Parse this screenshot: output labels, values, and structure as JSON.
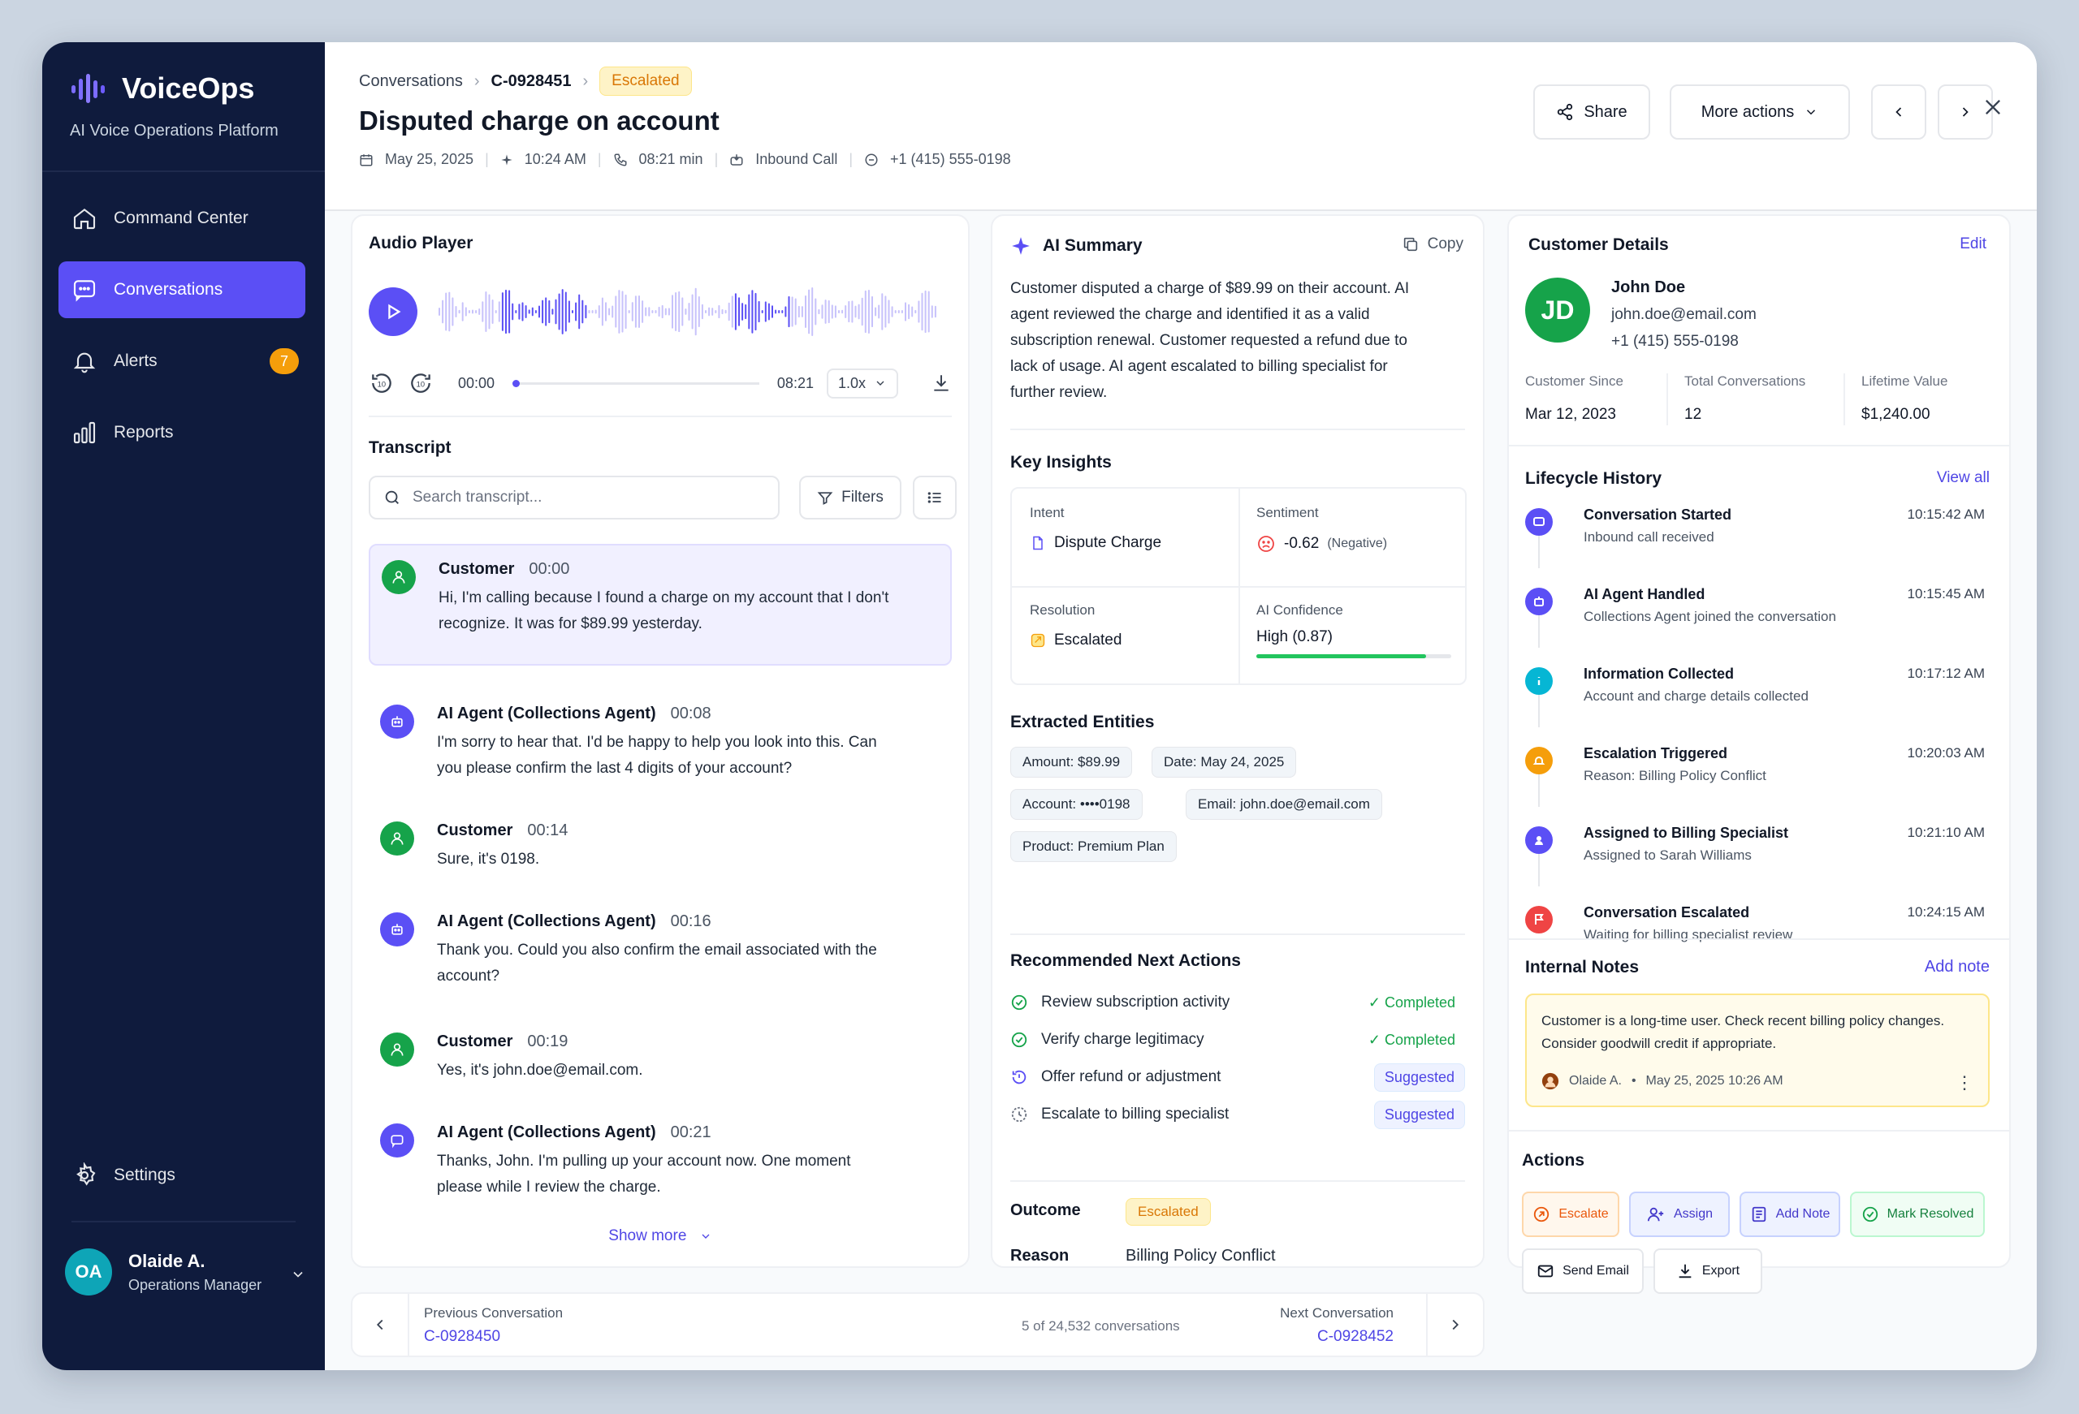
{
  "app": {
    "name": "VoiceOps",
    "subtitle": "AI Voice Operations Platform"
  },
  "sidebar": {
    "items": [
      {
        "label": "Command Center",
        "icon": "home-icon"
      },
      {
        "label": "Conversations",
        "icon": "chat-icon",
        "active": true
      },
      {
        "label": "Alerts",
        "icon": "bell-icon",
        "badge": "7"
      },
      {
        "label": "Reports",
        "icon": "bar-chart-icon"
      }
    ],
    "settings": "Settings",
    "user": {
      "initials": "OA",
      "name": "Olaide A.",
      "role": "Operations Manager"
    }
  },
  "header": {
    "breadcrumb": [
      "Conversations",
      "C-0928451"
    ],
    "status": "Escalated",
    "title": "Disputed charge on account",
    "meta": {
      "date": "May 25, 2025",
      "time": "10:24 AM",
      "duration": "08:21 min",
      "channel": "Inbound Call",
      "phone": "+1 (415) 555-0198"
    },
    "share": "Share",
    "more": "More actions"
  },
  "audio": {
    "title": "Audio Player",
    "current": "00:00",
    "total": "08:21",
    "speed": "1.0x",
    "progress": 0
  },
  "transcript": {
    "title": "Transcript",
    "search_placeholder": "Search transcript...",
    "filters": "Filters",
    "messages": [
      {
        "speaker": "Customer",
        "time": "00:00",
        "text": "Hi, I'm calling because I found a charge on my account that I don't recognize. It was for $89.99 yesterday."
      },
      {
        "speaker": "AI Agent (Collections Agent)",
        "time": "00:08",
        "text": "I'm sorry to hear that. I'd be happy to help you look into this. Can you please confirm the last 4 digits of your account?"
      },
      {
        "speaker": "Customer",
        "time": "00:14",
        "text": "Sure, it's 0198."
      },
      {
        "speaker": "AI Agent (Collections Agent)",
        "time": "00:16",
        "text": "Thank you. Could you also confirm the email associated with the account?"
      },
      {
        "speaker": "Customer",
        "time": "00:19",
        "text": "Yes, it's john.doe@email.com."
      },
      {
        "speaker": "AI Agent (Collections Agent)",
        "time": "00:21",
        "text": "Thanks, John. I'm pulling up your account now. One moment please while I review the charge."
      }
    ],
    "show_more": "Show more"
  },
  "summary": {
    "title": "AI Summary",
    "copy": "Copy",
    "text": "Customer disputed a charge of $89.99 on their account. AI agent reviewed the charge and identified it as a valid subscription renewal. Customer requested a refund due to lack of usage. AI agent escalated to billing specialist for further review.",
    "insights_title": "Key Insights",
    "intent_label": "Intent",
    "intent": "Dispute Charge",
    "sentiment_label": "Sentiment",
    "sentiment": "-0.62",
    "sentiment_note": "(Negative)",
    "resolution_label": "Resolution",
    "resolution": "Escalated",
    "confidence_label": "AI Confidence",
    "confidence": "High (0.87)",
    "confidence_value": 0.87,
    "entities_title": "Extracted Entities",
    "entities": [
      "Amount: $89.99",
      "Date: May 24, 2025",
      "Account: ••••0198",
      "Email: john.doe@email.com",
      "Product: Premium Plan"
    ],
    "actions_title": "Recommended Next Actions",
    "actions": [
      {
        "label": "Review subscription activity",
        "status": "Completed"
      },
      {
        "label": "Verify charge legitimacy",
        "status": "Completed"
      },
      {
        "label": "Offer refund or adjustment",
        "status": "Suggested"
      },
      {
        "label": "Escalate to billing specialist",
        "status": "Suggested"
      }
    ],
    "outcome_label": "Outcome",
    "outcome": "Escalated",
    "reason_label": "Reason",
    "reason": "Billing Policy Conflict"
  },
  "customer": {
    "title": "Customer Details",
    "edit": "Edit",
    "initials": "JD",
    "name": "John Doe",
    "email": "john.doe@email.com",
    "phone": "+1 (415) 555-0198",
    "stats": [
      {
        "label": "Customer Since",
        "value": "Mar 12, 2023"
      },
      {
        "label": "Total Conversations",
        "value": "12"
      },
      {
        "label": "Lifetime Value",
        "value": "$1,240.00"
      }
    ]
  },
  "lifecycle": {
    "title": "Lifecycle History",
    "view_all": "View all",
    "events": [
      {
        "title": "Conversation Started",
        "sub": "Inbound call received",
        "time": "10:15:42 AM",
        "color": "#5b4ff5",
        "icon": "chat-icon"
      },
      {
        "title": "AI Agent Handled",
        "sub": "Collections Agent joined the conversation",
        "time": "10:15:45 AM",
        "color": "#5b4ff5",
        "icon": "robot-icon"
      },
      {
        "title": "Information Collected",
        "sub": "Account and charge details collected",
        "time": "10:17:12 AM",
        "color": "#06b6d4",
        "icon": "info-icon"
      },
      {
        "title": "Escalation Triggered",
        "sub": "Reason: Billing Policy Conflict",
        "time": "10:20:03 AM",
        "color": "#f59e0b",
        "icon": "bell-icon"
      },
      {
        "title": "Assigned to Billing Specialist",
        "sub": "Assigned to Sarah Williams",
        "time": "10:21:10 AM",
        "color": "#5b4ff5",
        "icon": "user-icon"
      },
      {
        "title": "Conversation Escalated",
        "sub": "Waiting for billing specialist review",
        "time": "10:24:15 AM",
        "color": "#ef4444",
        "icon": "flag-icon"
      }
    ]
  },
  "notes": {
    "title": "Internal Notes",
    "add": "Add note",
    "text": "Customer is a long-time user. Check recent billing policy changes. Consider goodwill credit if appropriate.",
    "author": "Olaide A.",
    "date": "May 25, 2025 10:26 AM"
  },
  "actions": {
    "title": "Actions",
    "escalate": "Escalate",
    "assign": "Assign",
    "add_note": "Add Note",
    "resolve": "Mark Resolved",
    "email": "Send Email",
    "export": "Export"
  },
  "pager": {
    "prev_label": "Previous Conversation",
    "prev": "C-0928450",
    "count": "5 of 24,532 conversations",
    "next_label": "Next Conversation",
    "next": "C-0928452"
  },
  "colors": {
    "accent": "#5b4ff5",
    "sidebar": "#0f1b3d",
    "success": "#16a34a",
    "warning": "#f59e0b",
    "danger": "#ef4444"
  }
}
